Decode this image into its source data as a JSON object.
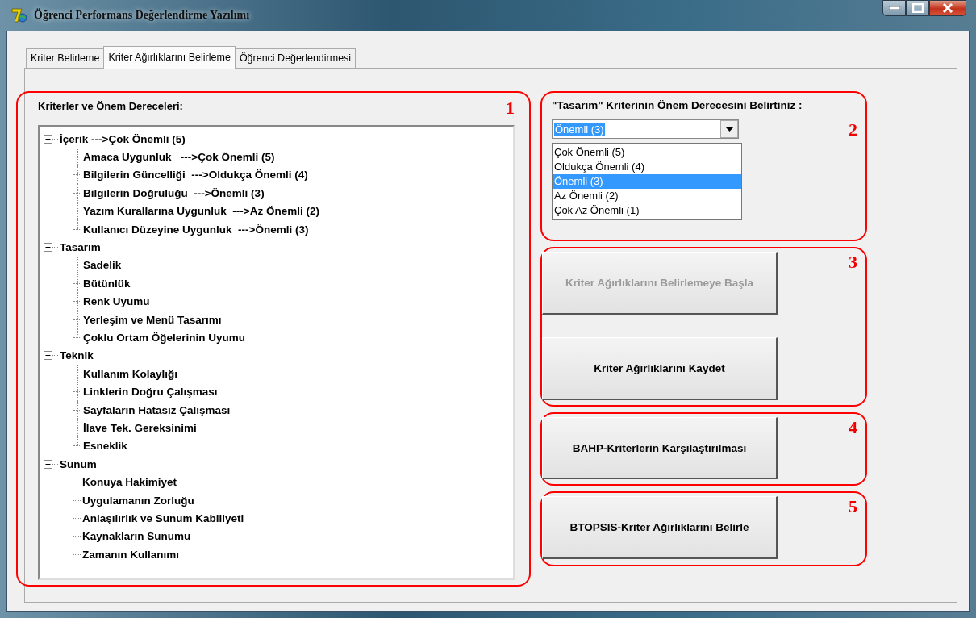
{
  "window": {
    "title": "Öğrenci Performans Değerlendirme Yazılımı"
  },
  "tabs": [
    {
      "label": "Kriter Belirleme",
      "selected": false
    },
    {
      "label": "Kriter Ağırlıklarını Belirleme",
      "selected": true
    },
    {
      "label": "Öğrenci Değerlendirmesi",
      "selected": false
    }
  ],
  "criteria_section": {
    "number": "1",
    "heading": "Kriterler ve Önem Dereceleri:",
    "tree": [
      {
        "label": "İçerik --->Çok Önemli (5)",
        "expanded": true,
        "children": [
          {
            "label": "Amaca Uygunluk   --->Çok Önemli (5)"
          },
          {
            "label": "Bilgilerin Güncelliği  --->Oldukça Önemli (4)"
          },
          {
            "label": "Bilgilerin Doğruluğu  --->Önemli (3)"
          },
          {
            "label": "Yazım Kurallarına Uygunluk  --->Az Önemli (2)"
          },
          {
            "label": "Kullanıcı Düzeyine Uygunluk  --->Önemli (3)"
          }
        ]
      },
      {
        "label": "Tasarım",
        "expanded": true,
        "children": [
          {
            "label": "Sadelik"
          },
          {
            "label": "Bütünlük"
          },
          {
            "label": "Renk Uyumu"
          },
          {
            "label": "Yerleşim ve Menü Tasarımı"
          },
          {
            "label": "Çoklu Ortam Öğelerinin Uyumu"
          }
        ]
      },
      {
        "label": "Teknik",
        "expanded": true,
        "children": [
          {
            "label": "Kullanım Kolaylığı"
          },
          {
            "label": "Linklerin Doğru Çalışması"
          },
          {
            "label": "Sayfaların Hatasız Çalışması"
          },
          {
            "label": "İlave Tek. Gereksinimi"
          },
          {
            "label": "Esneklik"
          }
        ]
      },
      {
        "label": "Sunum",
        "expanded": true,
        "children": [
          {
            "label": "Konuya Hakimiyet"
          },
          {
            "label": "Uygulamanın Zorluğu"
          },
          {
            "label": "Anlaşılırlık ve Sunum Kabiliyeti"
          },
          {
            "label": "Kaynakların Sunumu"
          },
          {
            "label": "Zamanın Kullanımı"
          }
        ]
      }
    ]
  },
  "importance_section": {
    "number": "2",
    "prompt": "\"Tasarım\" Kriterinin Önem Derecesini Belirtiniz :",
    "combo": {
      "value": "Önemli (3)"
    },
    "options": [
      {
        "label": "Çok Önemli (5)",
        "selected": false
      },
      {
        "label": "Oldukça Önemli (4)",
        "selected": false
      },
      {
        "label": "Önemli (3)",
        "selected": true
      },
      {
        "label": "Az Önemli (2)",
        "selected": false
      },
      {
        "label": "Çok Az Önemli (1)",
        "selected": false
      }
    ]
  },
  "action_sections": [
    {
      "number": "3",
      "buttons": [
        {
          "label": "Kriter Ağırlıklarını Belirlemeye Başla",
          "disabled": true
        },
        {
          "label": "Kriter Ağırlıklarını Kaydet",
          "disabled": false
        }
      ]
    },
    {
      "number": "4",
      "buttons": [
        {
          "label": "BAHP-Kriterlerin Karşılaştırılması",
          "disabled": false
        }
      ]
    },
    {
      "number": "5",
      "buttons": [
        {
          "label": "BTOPSIS-Kriter Ağırlıklarını Belirle",
          "disabled": false
        }
      ]
    }
  ]
}
